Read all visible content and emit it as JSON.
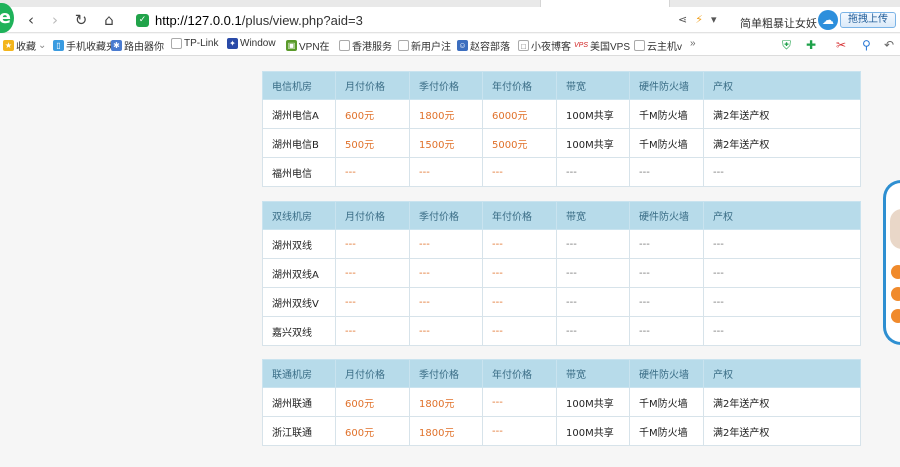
{
  "browser": {
    "url_host": "http://127.0.0.1",
    "url_path": "/plus/view.php?aid=3",
    "news_text": "简单粗暴让女妖",
    "upload_label": "拖拽上传",
    "bookmarks": [
      {
        "label": "收藏",
        "icon": "star-icon"
      },
      {
        "label": "手机收藏夹",
        "icon": "phone-icon"
      },
      {
        "label": "路由器你",
        "icon": "router-icon"
      },
      {
        "label": "TP-Link",
        "icon": "page-icon"
      },
      {
        "label": "Window",
        "icon": "window-icon"
      },
      {
        "label": "VPN在",
        "icon": "vpn-icon"
      },
      {
        "label": "香港服务",
        "icon": "page-icon"
      },
      {
        "label": "新用户注",
        "icon": "page-icon"
      },
      {
        "label": "赵容部落",
        "icon": "tribe-icon"
      },
      {
        "label": "小夜博客",
        "icon": "blog-icon"
      },
      {
        "label": "美国VPS",
        "icon": "vps-icon"
      },
      {
        "label": "云主机v",
        "icon": "page-icon"
      }
    ],
    "vps_badge": "VPS",
    "more": "»"
  },
  "tables": [
    {
      "headers": [
        "电信机房",
        "月付价格",
        "季付价格",
        "年付价格",
        "带宽",
        "硬件防火墙",
        "产权"
      ],
      "rows": [
        [
          "湖州电信A",
          "600元",
          "1800元",
          "6000元",
          "100M共享",
          "千M防火墙",
          "满2年送产权"
        ],
        [
          "湖州电信B",
          "500元",
          "1500元",
          "5000元",
          "100M共享",
          "千M防火墙",
          "满2年送产权"
        ],
        [
          "福州电信",
          "---",
          "---",
          "---",
          "---",
          "---",
          "---"
        ]
      ]
    },
    {
      "headers": [
        "双线机房",
        "月付价格",
        "季付价格",
        "年付价格",
        "带宽",
        "硬件防火墙",
        "产权"
      ],
      "rows": [
        [
          "湖州双线",
          "---",
          "---",
          "---",
          "---",
          "---",
          "---"
        ],
        [
          "湖州双线A",
          "---",
          "---",
          "---",
          "---",
          "---",
          "---"
        ],
        [
          "湖州双线V",
          "---",
          "---",
          "---",
          "---",
          "---",
          "---"
        ],
        [
          "嘉兴双线",
          "---",
          "---",
          "---",
          "---",
          "---",
          "---"
        ]
      ]
    },
    {
      "headers": [
        "联通机房",
        "月付价格",
        "季付价格",
        "年付价格",
        "带宽",
        "硬件防火墙",
        "产权"
      ],
      "rows": [
        [
          "湖州联通",
          "600元",
          "1800元",
          "---",
          "100M共享",
          "千M防火墙",
          "满2年送产权"
        ],
        [
          "浙江联通",
          "600元",
          "1800元",
          "---",
          "100M共享",
          "千M防火墙",
          "满2年送产权"
        ]
      ]
    }
  ],
  "colors": {
    "header_bg": "#b7dbea",
    "header_text": "#3a6d86",
    "price": "#e0712a",
    "brand": "#1fb25a"
  }
}
